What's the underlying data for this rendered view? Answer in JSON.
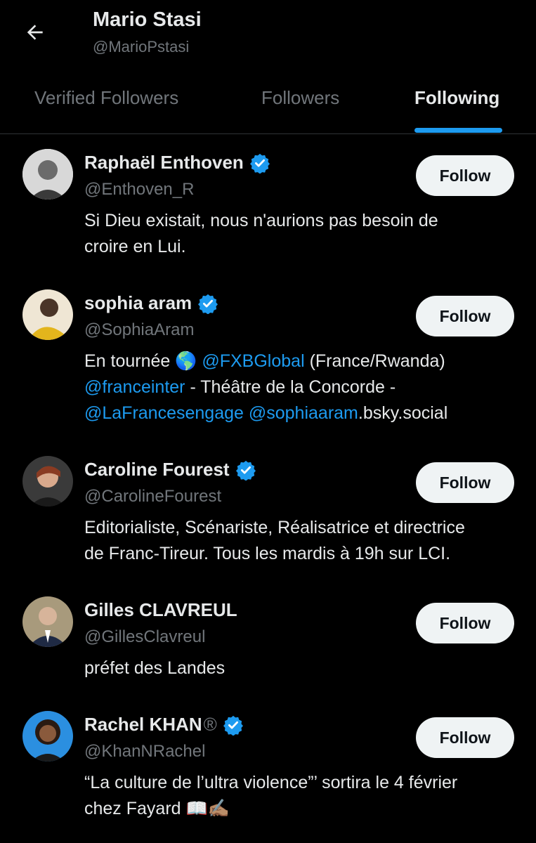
{
  "header": {
    "title": "Mario Stasi",
    "handle": "@MarioPstasi"
  },
  "tabs": [
    {
      "label": "Verified Followers",
      "active": false
    },
    {
      "label": "Followers",
      "active": false
    },
    {
      "label": "Following",
      "active": true
    }
  ],
  "users": [
    {
      "name": "Raphaël Enthoven",
      "handle": "@Enthoven_R",
      "verified": true,
      "follow_label": "Follow",
      "bio_line1": "Si Dieu existait, nous n'aurions pas besoin de",
      "bio_line2": "croire en Lui."
    },
    {
      "name": "sophia aram",
      "handle": "@SophiaAram",
      "verified": true,
      "follow_label": "Follow",
      "bio": {
        "t1": "En tournée ",
        "globe": "🌎",
        "m1": "@FXBGlobal",
        "t2": " (France/Rwanda)",
        "m2": "@franceinter",
        "t3": " - Théâtre de la Concorde -",
        "m3": "@LaFrancesengage",
        "t4": " ",
        "m4": "@sophiaaram",
        "t5": ".bsky.social"
      }
    },
    {
      "name": "Caroline Fourest",
      "handle": "@CarolineFourest",
      "verified": true,
      "follow_label": "Follow",
      "bio_line1": "Editorialiste, Scénariste, Réalisatrice et directrice",
      "bio_line2": "de Franc-Tireur. Tous les mardis à 19h sur LCI."
    },
    {
      "name": "Gilles CLAVREUL",
      "handle": "@GillesClavreul",
      "verified": false,
      "follow_label": "Follow",
      "bio_line1": "préfet des Landes"
    },
    {
      "name": "Rachel KHAN",
      "name_suffix": "®",
      "handle": "@KhanNRachel",
      "verified": true,
      "follow_label": "Follow",
      "bio_line1": "“La culture de l’ultra violence”’ sortira le 4 février",
      "bio_line2": "chez Fayard 📖✍🏽"
    }
  ],
  "colors": {
    "background": "#000000",
    "accent": "#1d9bf0",
    "text_primary": "#e7e9ea",
    "text_secondary": "#71767b",
    "button_bg": "#eff3f4"
  },
  "icons": [
    "back-arrow-icon",
    "verified-badge-icon",
    "globe-icon"
  ]
}
